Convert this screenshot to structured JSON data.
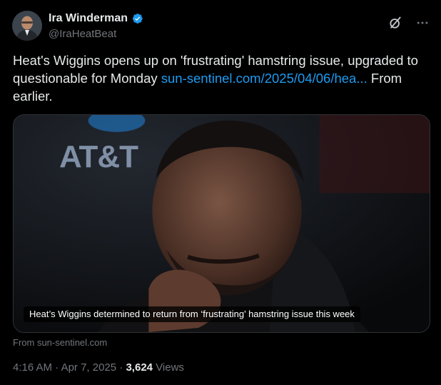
{
  "author": {
    "display_name": "Ira Winderman",
    "handle": "@IraHeatBeat",
    "verified": true
  },
  "tweet": {
    "text_before_link": "Heat's Wiggins opens up on 'frustrating' hamstring issue, upgraded to questionable for Monday ",
    "link_text": "sun-sentinel.com/2025/04/06/hea...",
    "text_after_link": " From earlier."
  },
  "card": {
    "headline": "Heat’s Wiggins determined to return from ‘frustrating’ hamstring issue this week",
    "background_logo_text": "AT&T",
    "source_label": "From sun-sentinel.com"
  },
  "meta": {
    "time": "4:16 AM",
    "separator": "·",
    "date": "Apr 7, 2025",
    "views_count": "3,624",
    "views_label": "Views"
  },
  "icons": {
    "verified": "verified-badge-icon",
    "grok": "grok-icon",
    "more": "more-options-icon"
  },
  "colors": {
    "background": "#000000",
    "text": "#e7e9ea",
    "secondary": "#71767b",
    "link": "#1d9bf0",
    "verified": "#1d9bf0",
    "border": "#2f3336"
  }
}
